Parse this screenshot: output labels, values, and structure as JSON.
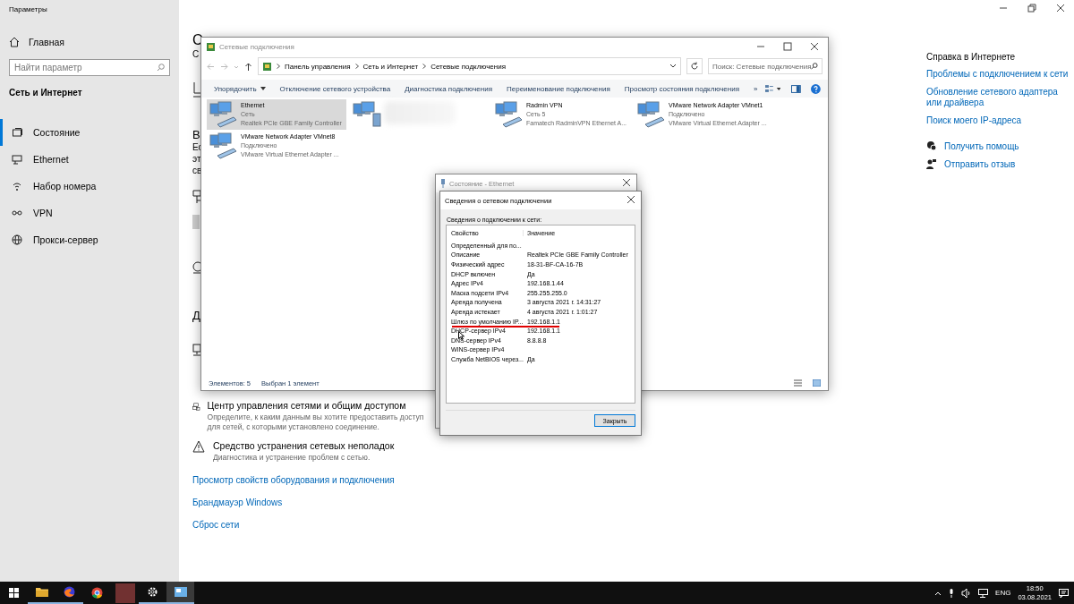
{
  "settings": {
    "title": "Параметры",
    "home": "Главная",
    "search_placeholder": "Найти параметр",
    "section": "Сеть и Интернет",
    "nav": [
      {
        "label": "Состояние",
        "selected": true
      },
      {
        "label": "Ethernet",
        "selected": false
      },
      {
        "label": "Набор номера",
        "selected": false
      },
      {
        "label": "VPN",
        "selected": false
      },
      {
        "label": "Прокси-сервер",
        "selected": false
      }
    ],
    "fragments": [
      {
        "text": "С",
        "kind": "title"
      },
      {
        "text": "С",
        "kind": "text"
      },
      {
        "text": "В",
        "kind": "heading"
      },
      {
        "text": "Ес",
        "kind": "text"
      },
      {
        "text": "эт",
        "kind": "text"
      },
      {
        "text": "св",
        "kind": "text"
      },
      {
        "text": "Д",
        "kind": "heading"
      }
    ],
    "items": [
      {
        "title": "Центр управления сетями и общим доступом",
        "description": "Определите, к каким данным вы хотите предоставить доступ для сетей, с которыми установлено соединение."
      },
      {
        "title": "Средство устранения сетевых неполадок",
        "description": "Диагностика и устранение проблем с сетью."
      }
    ],
    "links": [
      "Просмотр свойств оборудования и подключения",
      "Брандмауэр Windows",
      "Сброс сети"
    ],
    "help": {
      "title": "Справка в Интернете",
      "links": [
        "Проблемы с подключением к сети",
        "Обновление сетевого адаптера или драйвера",
        "Поиск моего IP-адреса"
      ],
      "actions": [
        "Получить помощь",
        "Отправить отзыв"
      ]
    }
  },
  "explorer": {
    "title": "Сетевые подключения",
    "breadcrumbs": [
      "Панель управления",
      "Сеть и Интернет",
      "Сетевые подключения"
    ],
    "search_placeholder": "Поиск: Сетевые подключения",
    "toolbar": [
      "Упорядочить",
      "Отключение сетевого устройства",
      "Диагностика подключения",
      "Переименование подключения",
      "Просмотр состояния подключения",
      "»"
    ],
    "items": [
      {
        "kind": "adapter",
        "name": "Ethernet",
        "status": "Сеть",
        "device": "Realtek PCIe GBE Family Controller",
        "selected": true
      },
      {
        "kind": "blurred",
        "selected": false
      },
      {
        "kind": "adapter",
        "name": "Radmin VPN",
        "status": "Сеть 5",
        "device": "Famatech RadminVPN Ethernet A...",
        "selected": false
      },
      {
        "kind": "adapter",
        "name": "VMware Network Adapter VMnet1",
        "status": "Подключено",
        "device": "VMware Virtual Ethernet Adapter ...",
        "selected": false
      },
      {
        "kind": "adapter",
        "name": "VMware Network Adapter VMnet8",
        "status": "Подключено",
        "device": "VMware Virtual Ethernet Adapter ...",
        "selected": false
      }
    ],
    "status_bar": [
      "Элементов: 5",
      "Выбран 1 элемент"
    ]
  },
  "status_dialog": {
    "title": "Состояние - Ethernet"
  },
  "details_dialog": {
    "title": "Сведения о сетевом подключении",
    "label": "Сведения о подключении к сети:",
    "columns": [
      "Свойство",
      "Значение"
    ],
    "rows": [
      {
        "property": "Определенный для по...",
        "value": "",
        "annotated": false
      },
      {
        "property": "Описание",
        "value": "Realtek PCIe GBE Family Controller",
        "annotated": false
      },
      {
        "property": "Физический адрес",
        "value": "18-31-BF-CA-16-7B",
        "annotated": false
      },
      {
        "property": "DHCP включен",
        "value": "Да",
        "annotated": false
      },
      {
        "property": "Адрес IPv4",
        "value": "192.168.1.44",
        "annotated": false
      },
      {
        "property": "Маска подсети IPv4",
        "value": "255.255.255.0",
        "annotated": false
      },
      {
        "property": "Аренда получена",
        "value": "3 августа 2021 г. 14:31:27",
        "annotated": false
      },
      {
        "property": "Аренда истекает",
        "value": "4 августа 2021 г. 1:01:27",
        "annotated": false
      },
      {
        "property": "Шлюз по умолчанию IP...",
        "value": "192.168.1.1",
        "annotated": true
      },
      {
        "property": "DHCP-сервер IPv4",
        "value": "192.168.1.1",
        "annotated": false
      },
      {
        "property": "DNS-сервер IPv4",
        "value": "8.8.8.8",
        "annotated": false
      },
      {
        "property": "WINS-сервер IPv4",
        "value": "",
        "annotated": false
      },
      {
        "property": "Служба NetBIOS через...",
        "value": "Да",
        "annotated": false
      }
    ],
    "button": "Закрыть"
  },
  "taskbar": {
    "apps": [
      {
        "running": true,
        "selected": false
      },
      {
        "running": true,
        "selected": false
      },
      {
        "running": false,
        "selected": false
      },
      {
        "running": false,
        "selected": false
      },
      {
        "running": true,
        "selected": false
      },
      {
        "running": true,
        "selected": true
      }
    ],
    "language": "ENG",
    "time": "18:50",
    "date": "03.08.2021"
  }
}
